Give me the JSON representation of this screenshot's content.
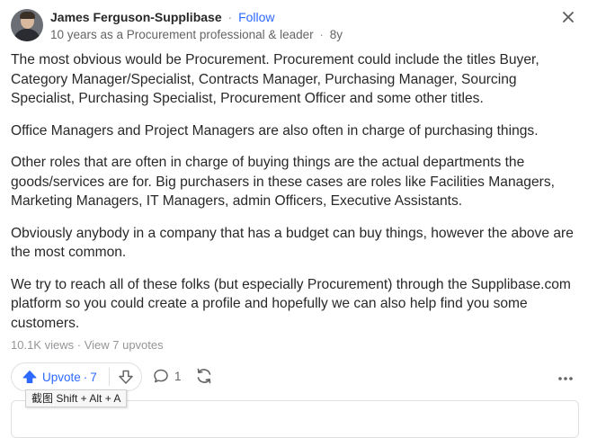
{
  "author": {
    "name": "James Ferguson-Supplibase",
    "follow_label": "Follow",
    "credential": "10 years as a Procurement professional & leader",
    "age": "8y",
    "separator": "·"
  },
  "answer": {
    "paragraphs": [
      "The most obvious would be Procurement. Procurement could include the titles Buyer, Category Manager/Specialist, Contracts Manager, Purchasing Manager, Sourcing Specialist, Purchasing Specialist, Procurement Officer and some other titles.",
      "Office Managers and Project Managers are also often in charge of purchasing things.",
      "Other roles that are often in charge of buying things are the actual departments the goods/services are for. Big purchasers in these cases are roles like Facilities Managers, Marketing Managers, IT Managers, admin Officers, Executive Assistants.",
      "Obviously anybody in a company that has a budget can buy things, however the above are the most common.",
      "We try to reach all of these folks (but especially Procurement) through the Supplibase.com platform so you could create a profile and hopefully we can also help find you some customers."
    ]
  },
  "stats": {
    "views": "10.1K views",
    "upvotes_link": "View 7 upvotes",
    "separator": "·"
  },
  "actions": {
    "upvote_label": "Upvote",
    "upvote_separator": "·",
    "upvote_count": "7",
    "comment_count": "1"
  },
  "tooltip": {
    "text": "截图 Shift + Alt + A"
  },
  "colors": {
    "accent": "#2e69ff",
    "text": "#282829",
    "muted": "#636466",
    "border": "#dee0e1"
  },
  "icons": {
    "close": "close-icon",
    "upvote": "upvote-arrow-icon",
    "downvote": "downvote-arrow-icon",
    "comment": "comment-bubble-icon",
    "share": "share-reload-icon",
    "more": "more-dots-icon"
  }
}
